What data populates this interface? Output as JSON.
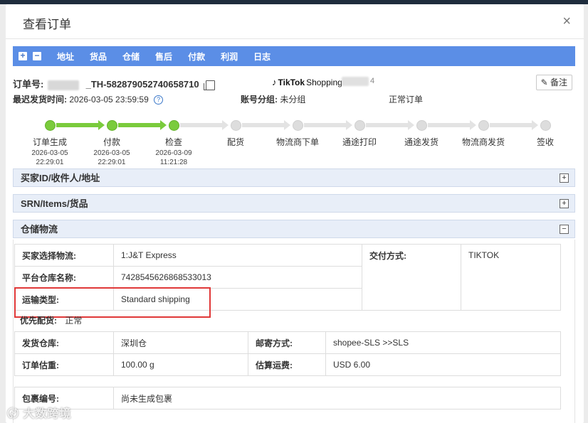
{
  "dialog": {
    "title": "查看订单",
    "close_label": "×"
  },
  "toolbar": {
    "expand_label": "+",
    "collapse_label": "−",
    "items": [
      "地址",
      "货品",
      "仓储",
      "售后",
      "付款",
      "利润",
      "日志"
    ]
  },
  "order": {
    "no_label": "订单号:",
    "no_value": "_TH-582879052740658710",
    "platform_name": "TikTok",
    "platform_suffix": "Shopping",
    "masked_tail": "4",
    "remark_button": "备注",
    "latest_ship_label": "最迟发货时间:",
    "latest_ship_value": "2026-03-05 23:59:59",
    "help_glyph": "?",
    "account_group_label": "账号分组:",
    "account_group_value": "未分组",
    "status": "正常订单"
  },
  "progress": {
    "steps": [
      {
        "name": "订单生成",
        "date": "2026-03-05",
        "time": "22:29:01",
        "done": true
      },
      {
        "name": "付款",
        "date": "2026-03-05",
        "time": "22:29:01",
        "done": true
      },
      {
        "name": "检查",
        "date": "2026-03-09",
        "time": "11:21:28",
        "done": true
      },
      {
        "name": "配货",
        "date": "",
        "time": "",
        "done": false
      },
      {
        "name": "物流商下单",
        "date": "",
        "time": "",
        "done": false
      },
      {
        "name": "通途打印",
        "date": "",
        "time": "",
        "done": false
      },
      {
        "name": "通途发货",
        "date": "",
        "time": "",
        "done": false
      },
      {
        "name": "物流商发货",
        "date": "",
        "time": "",
        "done": false
      },
      {
        "name": "签收",
        "date": "",
        "time": "",
        "done": false
      }
    ]
  },
  "panels": {
    "buyer": {
      "title": "买家ID/收件人/地址",
      "toggle": "+"
    },
    "items": {
      "title": "SRN/Items/货品",
      "toggle": "+"
    },
    "warehouse": {
      "title": "仓储物流",
      "toggle": "−"
    }
  },
  "logistics": {
    "buyer_selected_label": "买家选择物流:",
    "buyer_selected_value": "1:J&T Express",
    "delivery_method_label": "交付方式:",
    "delivery_method_value": "TIKTOK",
    "platform_warehouse_label": "平台仓库名称:",
    "platform_warehouse_value": "7428545626868533013",
    "shipping_type_label": "运输类型:",
    "shipping_type_value": "Standard shipping",
    "priority_label": "优先配货:",
    "priority_value": "正常",
    "ship_warehouse_label": "发货仓库:",
    "ship_warehouse_value": "深圳仓",
    "mail_method_label": "邮寄方式:",
    "mail_method_value": "shopee-SLS >>SLS",
    "weight_label": "订单估重:",
    "weight_value": "100.00 g",
    "freight_label": "估算运费:",
    "freight_value": "USD 6.00",
    "package_label": "包裹编号:",
    "package_value": "尚未生成包裹"
  },
  "watermark": "大数跨境",
  "colors": {
    "toolbar": "#5b8ee6",
    "step_done": "#7acb3c",
    "highlight": "#e03838"
  }
}
